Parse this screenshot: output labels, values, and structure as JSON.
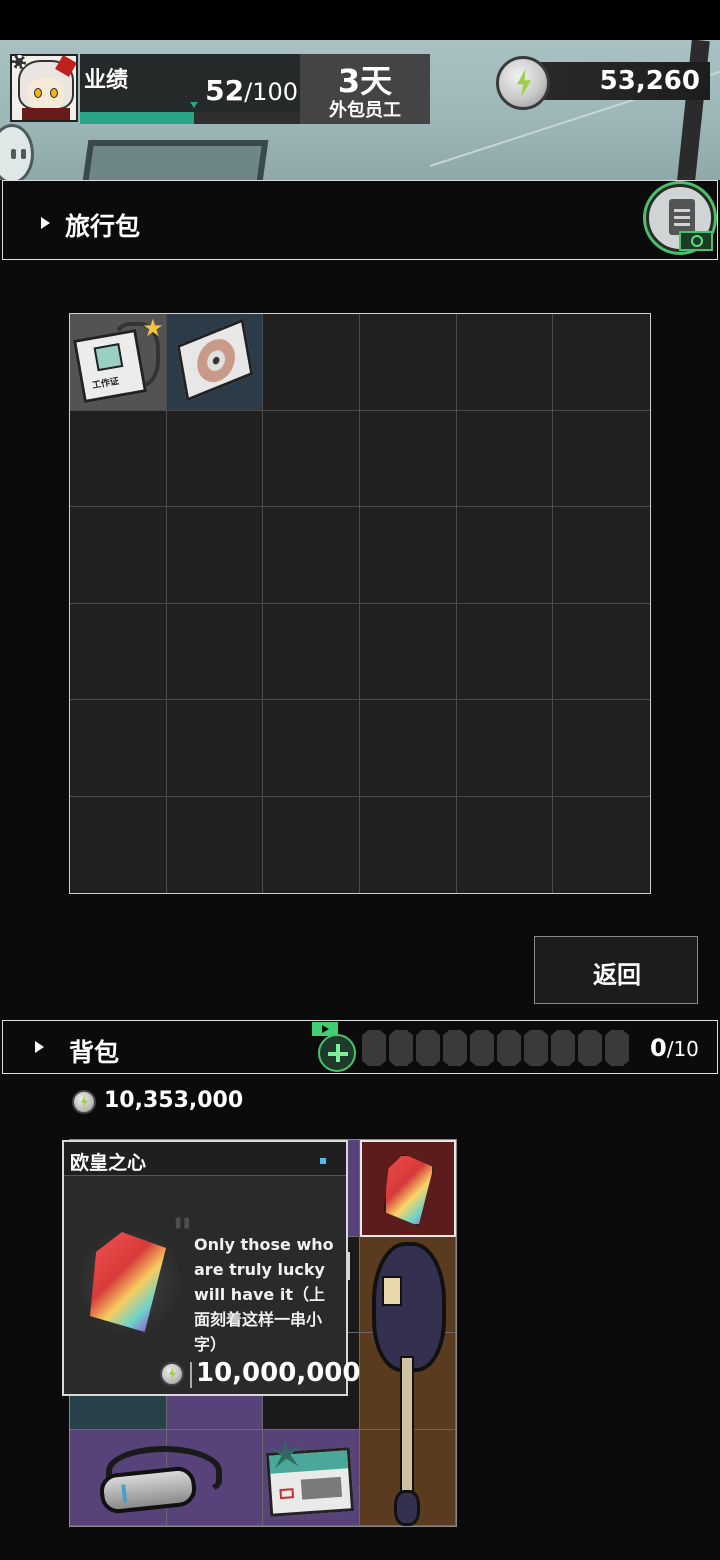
{
  "header": {
    "performance_label": "业绩",
    "performance_value": "52",
    "performance_max": "/100",
    "performance_fraction": 0.52,
    "days_value": "3天",
    "role_label": "外包员工",
    "coins": "53,260"
  },
  "travel_bag": {
    "title": "旅行包",
    "grid_cols": 6,
    "grid_rows": 6,
    "items": [
      {
        "name": "工作证",
        "icon": "id-card-icon",
        "starred": true
      },
      {
        "name": "",
        "icon": "disc-icon"
      }
    ]
  },
  "back_button": "返回",
  "backpack": {
    "title": "背包",
    "slot_used": "0",
    "slot_max": "/10",
    "money": "10,353,000",
    "items": [
      {
        "icon": "gem-icon"
      },
      {
        "icon": "guitar-icon"
      },
      {
        "icon": "vr-headset-icon"
      },
      {
        "icon": "ticket-icon"
      }
    ]
  },
  "tooltip": {
    "item_name": "欧皇之心",
    "description": "Only those who are truly lucky will have it（上面刻着这样一串小字）",
    "price": "10,000,000"
  },
  "colors": {
    "accent_green": "#29a487",
    "highlight_green": "#4ac26b",
    "star_gold": "#f4c43e"
  }
}
